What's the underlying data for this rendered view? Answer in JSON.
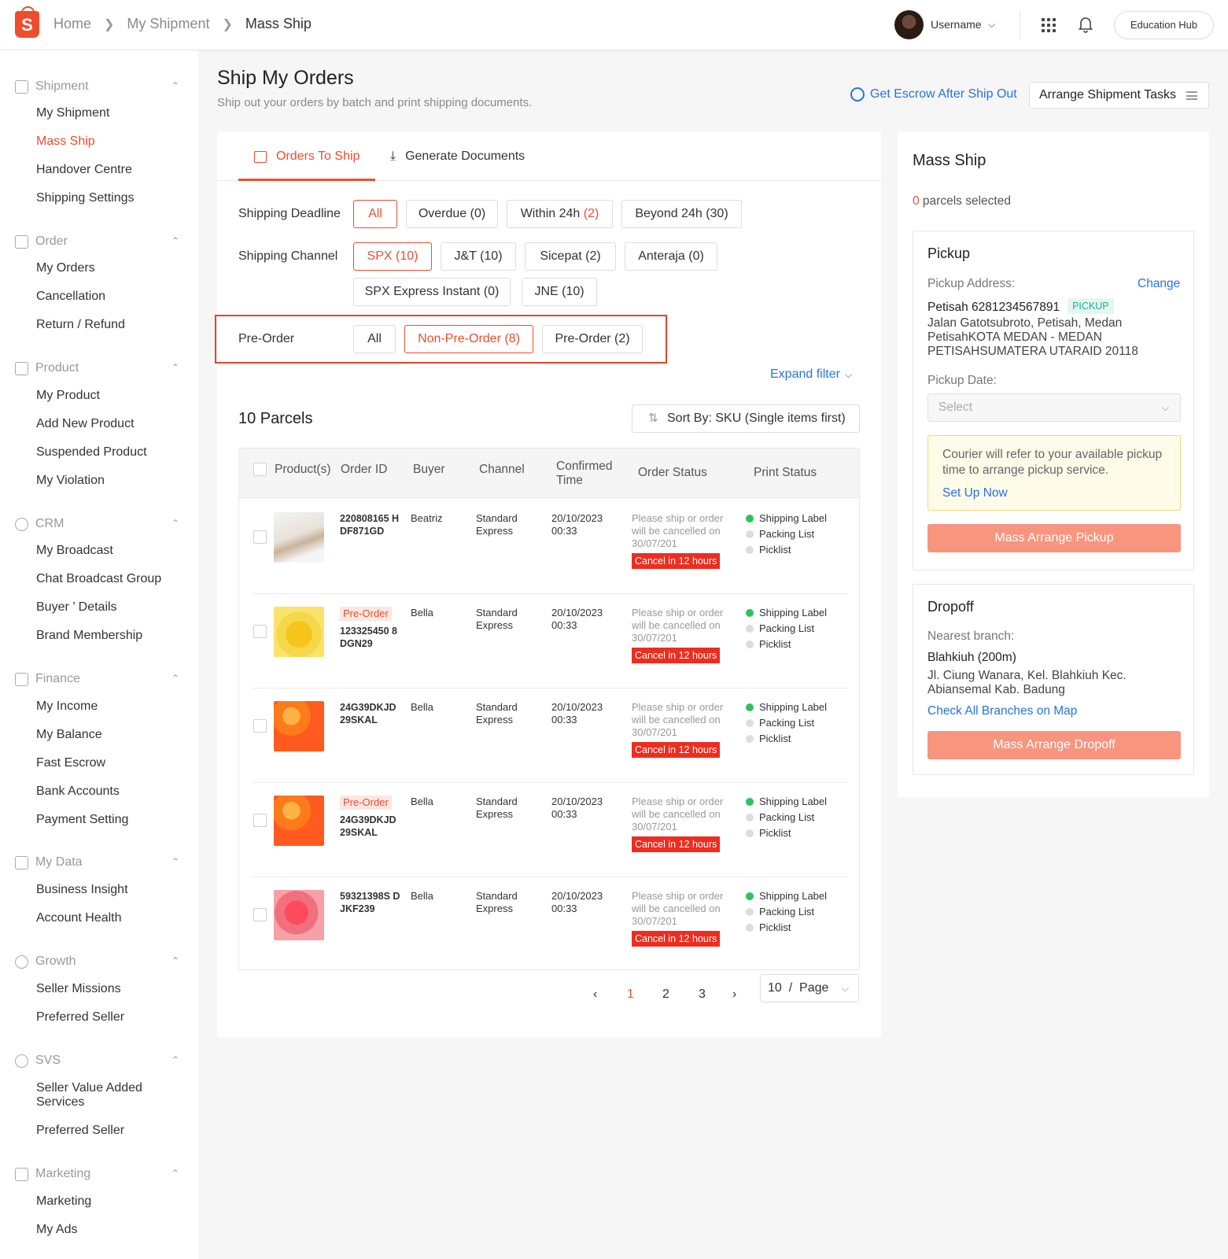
{
  "header": {
    "breadcrumb": [
      "Home",
      "My Shipment",
      "Mass Ship"
    ],
    "username": "Username",
    "education_hub": "Education Hub"
  },
  "sidebar": {
    "groups": [
      {
        "title": "Shipment",
        "icon": "shipment-icon",
        "items": [
          "My Shipment",
          "Mass Ship",
          "Handover Centre",
          "Shipping Settings"
        ]
      },
      {
        "title": "Order",
        "icon": "order-icon",
        "items": [
          "My Orders",
          "Cancellation",
          "Return / Refund"
        ]
      },
      {
        "title": "Product",
        "icon": "product-icon",
        "items": [
          "My Product",
          "Add New Product",
          "Suspended Product",
          "My Violation"
        ]
      },
      {
        "title": "CRM",
        "icon": "crm-icon",
        "items": [
          "My Broadcast",
          "Chat Broadcast Group",
          "Buyer ’ Details",
          "Brand Membership"
        ]
      },
      {
        "title": "Finance",
        "icon": "finance-icon",
        "items": [
          "My Income",
          "My Balance",
          "Fast Escrow",
          "Bank Accounts",
          "Payment Setting"
        ]
      },
      {
        "title": "My Data",
        "icon": "chart-icon",
        "items": [
          "Business Insight",
          "Account Health"
        ]
      },
      {
        "title": "Growth",
        "icon": "growth-icon",
        "items": [
          "Seller Missions",
          "Preferred Seller"
        ]
      },
      {
        "title": "SVS",
        "icon": "svs-icon",
        "items": [
          "Seller Value Added Services",
          "Preferred Seller"
        ]
      },
      {
        "title": "Marketing",
        "icon": "tag-icon",
        "items": [
          "Marketing",
          "My Ads"
        ]
      }
    ],
    "active_item": "Mass Ship"
  },
  "page": {
    "title": "Ship My Orders",
    "subtitle": "Ship out your orders by batch and print shipping documents.",
    "escrow_link": "Get Escrow After Ship Out",
    "tasks_button": "Arrange Shipment Tasks"
  },
  "tabs": {
    "orders_to_ship": "Orders To Ship",
    "generate_documents": "Generate Documents"
  },
  "filters": {
    "deadline_label": "Shipping Deadline",
    "deadline": {
      "all": "All",
      "overdue": "Overdue (0)",
      "within_prefix": "Within 24h ",
      "within_count": "(2)",
      "beyond": "Beyond 24h (30)"
    },
    "channel_label": "Shipping Channel",
    "channels": [
      "SPX (10)",
      "J&T (10)",
      "Sicepat (2)",
      "Anteraja (0)",
      "SPX Express Instant (0)",
      "JNE (10)"
    ],
    "preorder_label": "Pre-Order",
    "preorder": [
      "All",
      "Non-Pre-Order (8)",
      "Pre-Order (2)"
    ],
    "expand": "Expand filter"
  },
  "list": {
    "count": "10 Parcels",
    "sort": "Sort By: SKU (Single items first)",
    "columns": {
      "products": "Product(s)",
      "order_id": "Order ID",
      "buyer": "Buyer",
      "channel": "Channel",
      "confirmed": "Confirmed Time",
      "status": "Order Status",
      "print": "Print Status"
    },
    "rows": [
      {
        "preorder": "",
        "order_id": "220808165 HDF871GD",
        "buyer": "Beatriz",
        "channel": "Standard Express",
        "time": "20/10/2023 00:33",
        "status": "Please ship or order will be cancelled on 30/07/201",
        "badge": "Cancel in 12 hours",
        "print": [
          "Shipping Label",
          "Packing List",
          "Picklist"
        ]
      },
      {
        "preorder": "Pre-Order",
        "order_id": "123325450 8DGN29",
        "buyer": "Bella",
        "channel": "Standard Express",
        "time": "20/10/2023 00:33",
        "status": "Please ship or order will be cancelled on 30/07/201",
        "badge": "Cancel in 12 hours",
        "print": [
          "Shipping Label",
          "Packing List",
          "Picklist"
        ]
      },
      {
        "preorder": "",
        "order_id": "24G39DKJD 29SKAL",
        "buyer": "Bella",
        "channel": "Standard Express",
        "time": "20/10/2023 00:33",
        "status": "Please ship or order will be cancelled on 30/07/201",
        "badge": "Cancel in 12 hours",
        "print": [
          "Shipping Label",
          "Packing List",
          "Picklist"
        ]
      },
      {
        "preorder": "Pre-Order",
        "order_id": "24G39DKJD 29SKAL",
        "buyer": "Bella",
        "channel": "Standard Express",
        "time": "20/10/2023 00:33",
        "status": "Please ship or order will be cancelled on 30/07/201",
        "badge": "Cancel in 12 hours",
        "print": [
          "Shipping Label",
          "Packing List",
          "Picklist"
        ]
      },
      {
        "preorder": "",
        "order_id": "59321398S DJKF239",
        "buyer": "Bella",
        "channel": "Standard Express",
        "time": "20/10/2023 00:33",
        "status": "Please ship or order will be cancelled on 30/07/201",
        "badge": "Cancel in 12 hours",
        "print": [
          "Shipping Label",
          "Packing List",
          "Picklist"
        ]
      }
    ],
    "pagination": {
      "pages": [
        "1",
        "2",
        "3"
      ],
      "current": "1",
      "size": "10",
      "sep": "/",
      "unit": "Page"
    }
  },
  "mass_ship": {
    "title": "Mass Ship",
    "selected_count": "0",
    "selected_text": " parcels selected",
    "pickup": {
      "title": "Pickup",
      "address_label": "Pickup Address:",
      "change": "Change",
      "name": "Petisah 6281234567891",
      "tag": "PICKUP",
      "address": "Jalan Gatotsubroto, Petisah, Medan PetisahKOTA MEDAN - MEDAN PETISAHSUMATERA UTARAID 20118",
      "date_label": "Pickup Date:",
      "date_placeholder": "Select",
      "notice": "Courier will refer to your available pickup time to arrange pickup service.",
      "setup": "Set Up Now",
      "button": "Mass Arrange Pickup"
    },
    "dropoff": {
      "title": "Dropoff",
      "nearest_label": "Nearest branch:",
      "branch": "Blahkiuh (200m)",
      "address": "Jl. Ciung Wanara, Kel. Blahkiuh Kec. Abiansemal Kab. Badung",
      "map_link": "Check All Branches on Map",
      "button": "Mass Arrange Dropoff"
    }
  },
  "colors": {
    "brand": "#ee4d2d",
    "link": "#2673dd",
    "success": "#2ec25a"
  }
}
